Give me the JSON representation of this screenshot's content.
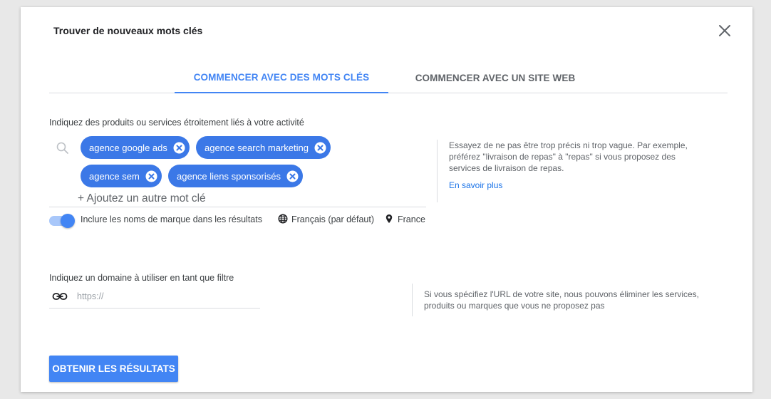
{
  "dialog": {
    "title": "Trouver de nouveaux mots clés"
  },
  "tabs": [
    {
      "label": "COMMENCER AVEC DES MOTS CLÉS",
      "active": true
    },
    {
      "label": "COMMENCER AVEC UN SITE WEB",
      "active": false
    }
  ],
  "keywords_section": {
    "label": "Indiquez des produits ou services étroitement liés à votre activité",
    "chips": [
      {
        "label": "agence google ads"
      },
      {
        "label": "agence search marketing"
      },
      {
        "label": "agence sem"
      },
      {
        "label": "agence liens sponsorisés"
      }
    ],
    "add_placeholder": "+ Ajoutez un autre mot clé",
    "include_brands_label": "Inclure les noms de marque dans les résultats",
    "include_brands_on": true,
    "language": "Français (par défaut)",
    "location": "France",
    "help_text": "Essayez de ne pas être trop précis ni trop vague. Par exemple, préférez \"livraison de repas\" à \"repas\" si vous proposez des services de livraison de repas.",
    "help_link": "En savoir plus"
  },
  "domain_section": {
    "label": "Indiquez un domaine à utiliser en tant que filtre",
    "input_placeholder": "https://",
    "input_value": "",
    "help_text": "Si vous spécifiez l'URL de votre site, nous pouvons éliminer les services, produits ou marques que vous ne proposez pas"
  },
  "actions": {
    "submit_label": "OBTENIR LES RÉSULTATS"
  },
  "colors": {
    "accent": "#4285f4",
    "chip": "#3b78e7",
    "link": "#1a73e8"
  },
  "icons": [
    "close-icon",
    "search-icon",
    "chip-remove-icon",
    "globe-icon",
    "location-pin-icon",
    "link-icon"
  ]
}
